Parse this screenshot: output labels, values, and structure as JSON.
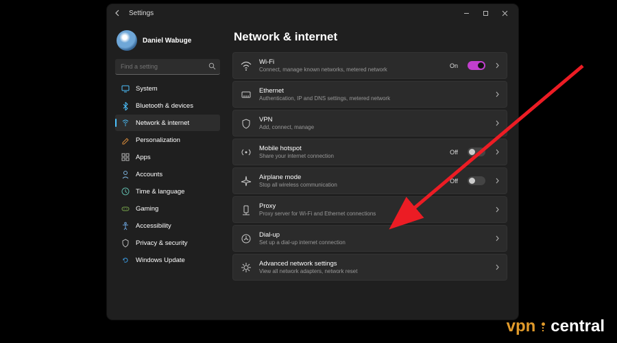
{
  "window": {
    "title": "Settings"
  },
  "user": {
    "name": "Daniel Wabuge"
  },
  "search": {
    "placeholder": "Find a setting"
  },
  "nav": [
    {
      "key": "system",
      "label": "System",
      "color": "#4cc2ff",
      "active": false
    },
    {
      "key": "bluetooth",
      "label": "Bluetooth & devices",
      "color": "#4cc2ff",
      "active": false
    },
    {
      "key": "network",
      "label": "Network & internet",
      "color": "#4cc2ff",
      "active": true
    },
    {
      "key": "personalization",
      "label": "Personalization",
      "color": "#d98b3a",
      "active": false
    },
    {
      "key": "apps",
      "label": "Apps",
      "color": "#b9b9b9",
      "active": false
    },
    {
      "key": "accounts",
      "label": "Accounts",
      "color": "#7fb6e0",
      "active": false
    },
    {
      "key": "time",
      "label": "Time & language",
      "color": "#5fb8a9",
      "active": false
    },
    {
      "key": "gaming",
      "label": "Gaming",
      "color": "#7aa84c",
      "active": false
    },
    {
      "key": "accessibility",
      "label": "Accessibility",
      "color": "#6aa0d8",
      "active": false
    },
    {
      "key": "privacy",
      "label": "Privacy & security",
      "color": "#b9b9b9",
      "active": false
    },
    {
      "key": "update",
      "label": "Windows Update",
      "color": "#3b9ae0",
      "active": false
    }
  ],
  "page": {
    "heading": "Network & internet",
    "items": [
      {
        "key": "wifi",
        "title": "Wi-Fi",
        "desc": "Connect, manage known networks, metered network",
        "toggle": true,
        "toggleOn": true,
        "state": "On"
      },
      {
        "key": "ethernet",
        "title": "Ethernet",
        "desc": "Authentication, IP and DNS settings, metered network"
      },
      {
        "key": "vpn",
        "title": "VPN",
        "desc": "Add, connect, manage"
      },
      {
        "key": "hotspot",
        "title": "Mobile hotspot",
        "desc": "Share your internet connection",
        "toggle": true,
        "toggleOn": false,
        "state": "Off"
      },
      {
        "key": "airplane",
        "title": "Airplane mode",
        "desc": "Stop all wireless communication",
        "toggle": true,
        "toggleOn": false,
        "state": "Off"
      },
      {
        "key": "proxy",
        "title": "Proxy",
        "desc": "Proxy server for Wi-Fi and Ethernet connections"
      },
      {
        "key": "dialup",
        "title": "Dial-up",
        "desc": "Set up a dial-up internet connection"
      },
      {
        "key": "advanced",
        "title": "Advanced network settings",
        "desc": "View all network adapters, network reset"
      }
    ]
  },
  "watermark": {
    "left": "vpn",
    "right": "central"
  },
  "annotation": {
    "color": "#ec1c24"
  }
}
